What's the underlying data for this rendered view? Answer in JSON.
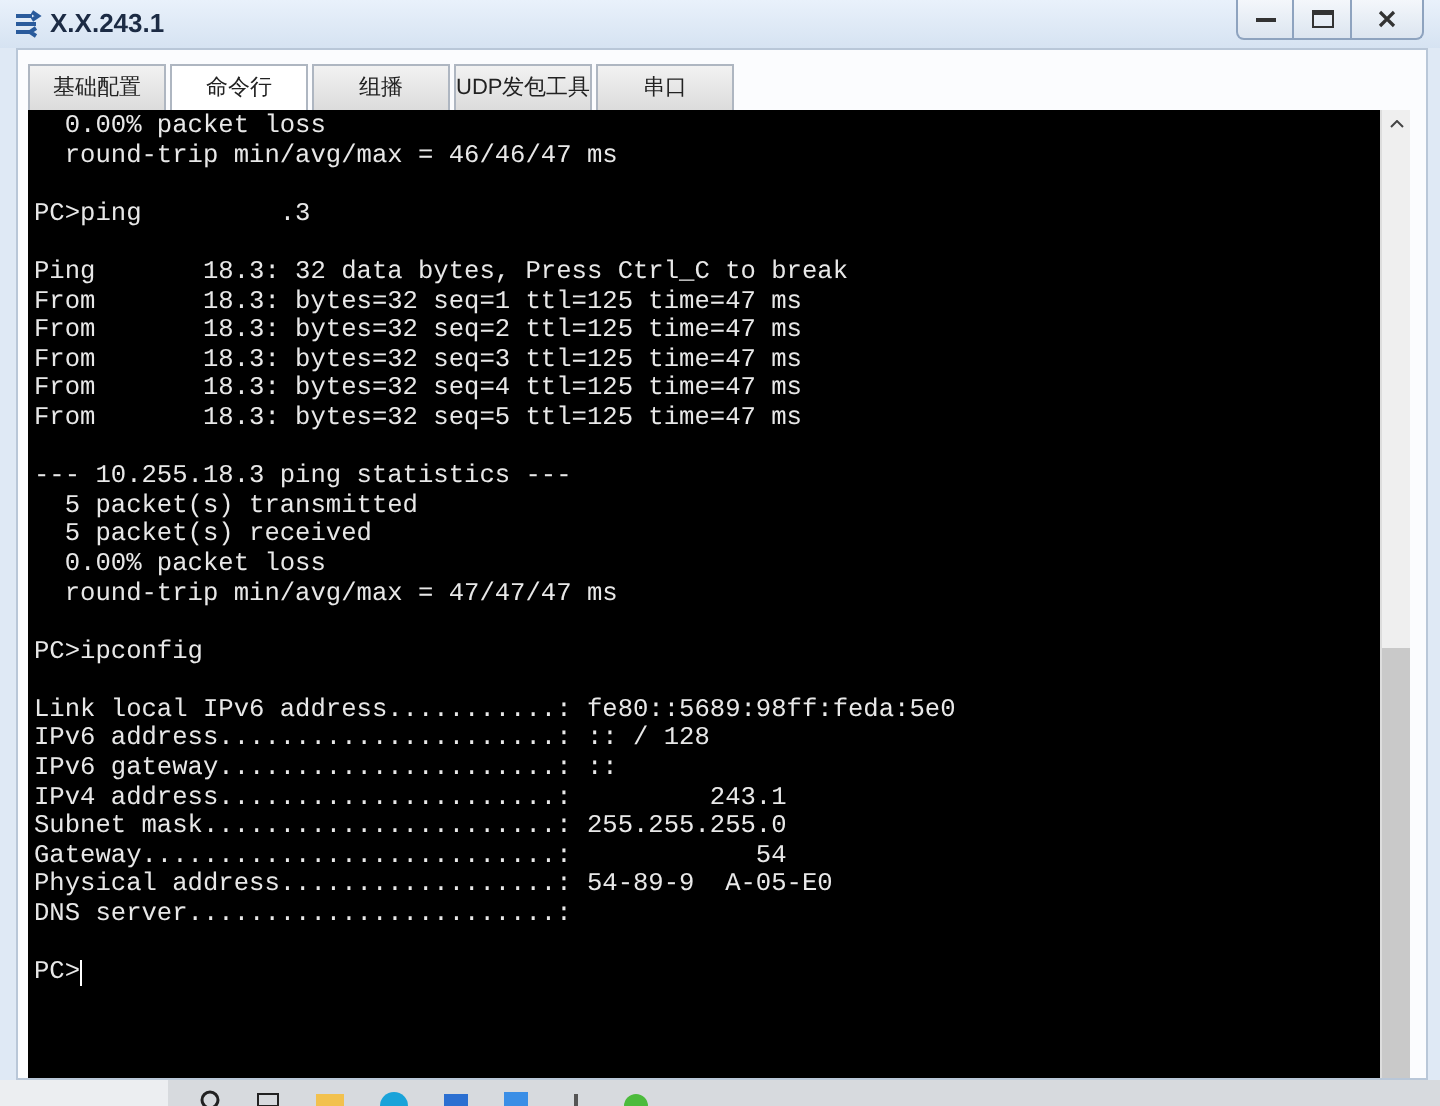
{
  "window": {
    "title": "X.X.243.1"
  },
  "tabs": [
    {
      "label": "基础配置",
      "selected": false
    },
    {
      "label": "命令行",
      "selected": true
    },
    {
      "label": "组播",
      "selected": false
    },
    {
      "label": "UDP发包工具",
      "selected": false
    },
    {
      "label": "串口",
      "selected": false
    }
  ],
  "terminal": {
    "lines": [
      {
        "kind": "text",
        "text": "  0.00% packet loss"
      },
      {
        "kind": "text",
        "text": "  round-trip min/avg/max = 46/46/47 ms"
      },
      {
        "kind": "blank"
      },
      {
        "kind": "text",
        "text": "PC>ping         .3"
      },
      {
        "kind": "blank"
      },
      {
        "kind": "text",
        "text": "Ping       18.3: 32 data bytes, Press Ctrl_C to break"
      },
      {
        "kind": "text",
        "text": "From       18.3: bytes=32 seq=1 ttl=125 time=47 ms"
      },
      {
        "kind": "text",
        "text": "From       18.3: bytes=32 seq=2 ttl=125 time=47 ms"
      },
      {
        "kind": "text",
        "text": "From       18.3: bytes=32 seq=3 ttl=125 time=47 ms"
      },
      {
        "kind": "text",
        "text": "From       18.3: bytes=32 seq=4 ttl=125 time=47 ms"
      },
      {
        "kind": "text",
        "text": "From       18.3: bytes=32 seq=5 ttl=125 time=47 ms"
      },
      {
        "kind": "blank"
      },
      {
        "kind": "text",
        "text": "--- 10.255.18.3 ping statistics ---"
      },
      {
        "kind": "text",
        "text": "  5 packet(s) transmitted"
      },
      {
        "kind": "text",
        "text": "  5 packet(s) received"
      },
      {
        "kind": "text",
        "text": "  0.00% packet loss"
      },
      {
        "kind": "text",
        "text": "  round-trip min/avg/max = 47/47/47 ms"
      },
      {
        "kind": "blank"
      },
      {
        "kind": "text",
        "text": "PC>ipconfig"
      },
      {
        "kind": "blank"
      },
      {
        "kind": "text",
        "text": "Link local IPv6 address...........: fe80::5689:98ff:feda:5e0"
      },
      {
        "kind": "text",
        "text": "IPv6 address......................: :: / 128"
      },
      {
        "kind": "text",
        "text": "IPv6 gateway......................: ::"
      },
      {
        "kind": "text",
        "text": "IPv4 address......................:         243.1"
      },
      {
        "kind": "text",
        "text": "Subnet mask.......................: 255.255.255.0"
      },
      {
        "kind": "text",
        "text": "Gateway...........................:            54"
      },
      {
        "kind": "text",
        "text": "Physical address..................: 54-89-9  A-05-E0"
      },
      {
        "kind": "text",
        "text": "DNS server........................:"
      },
      {
        "kind": "blank"
      },
      {
        "kind": "prompt",
        "text": "PC>"
      }
    ]
  }
}
